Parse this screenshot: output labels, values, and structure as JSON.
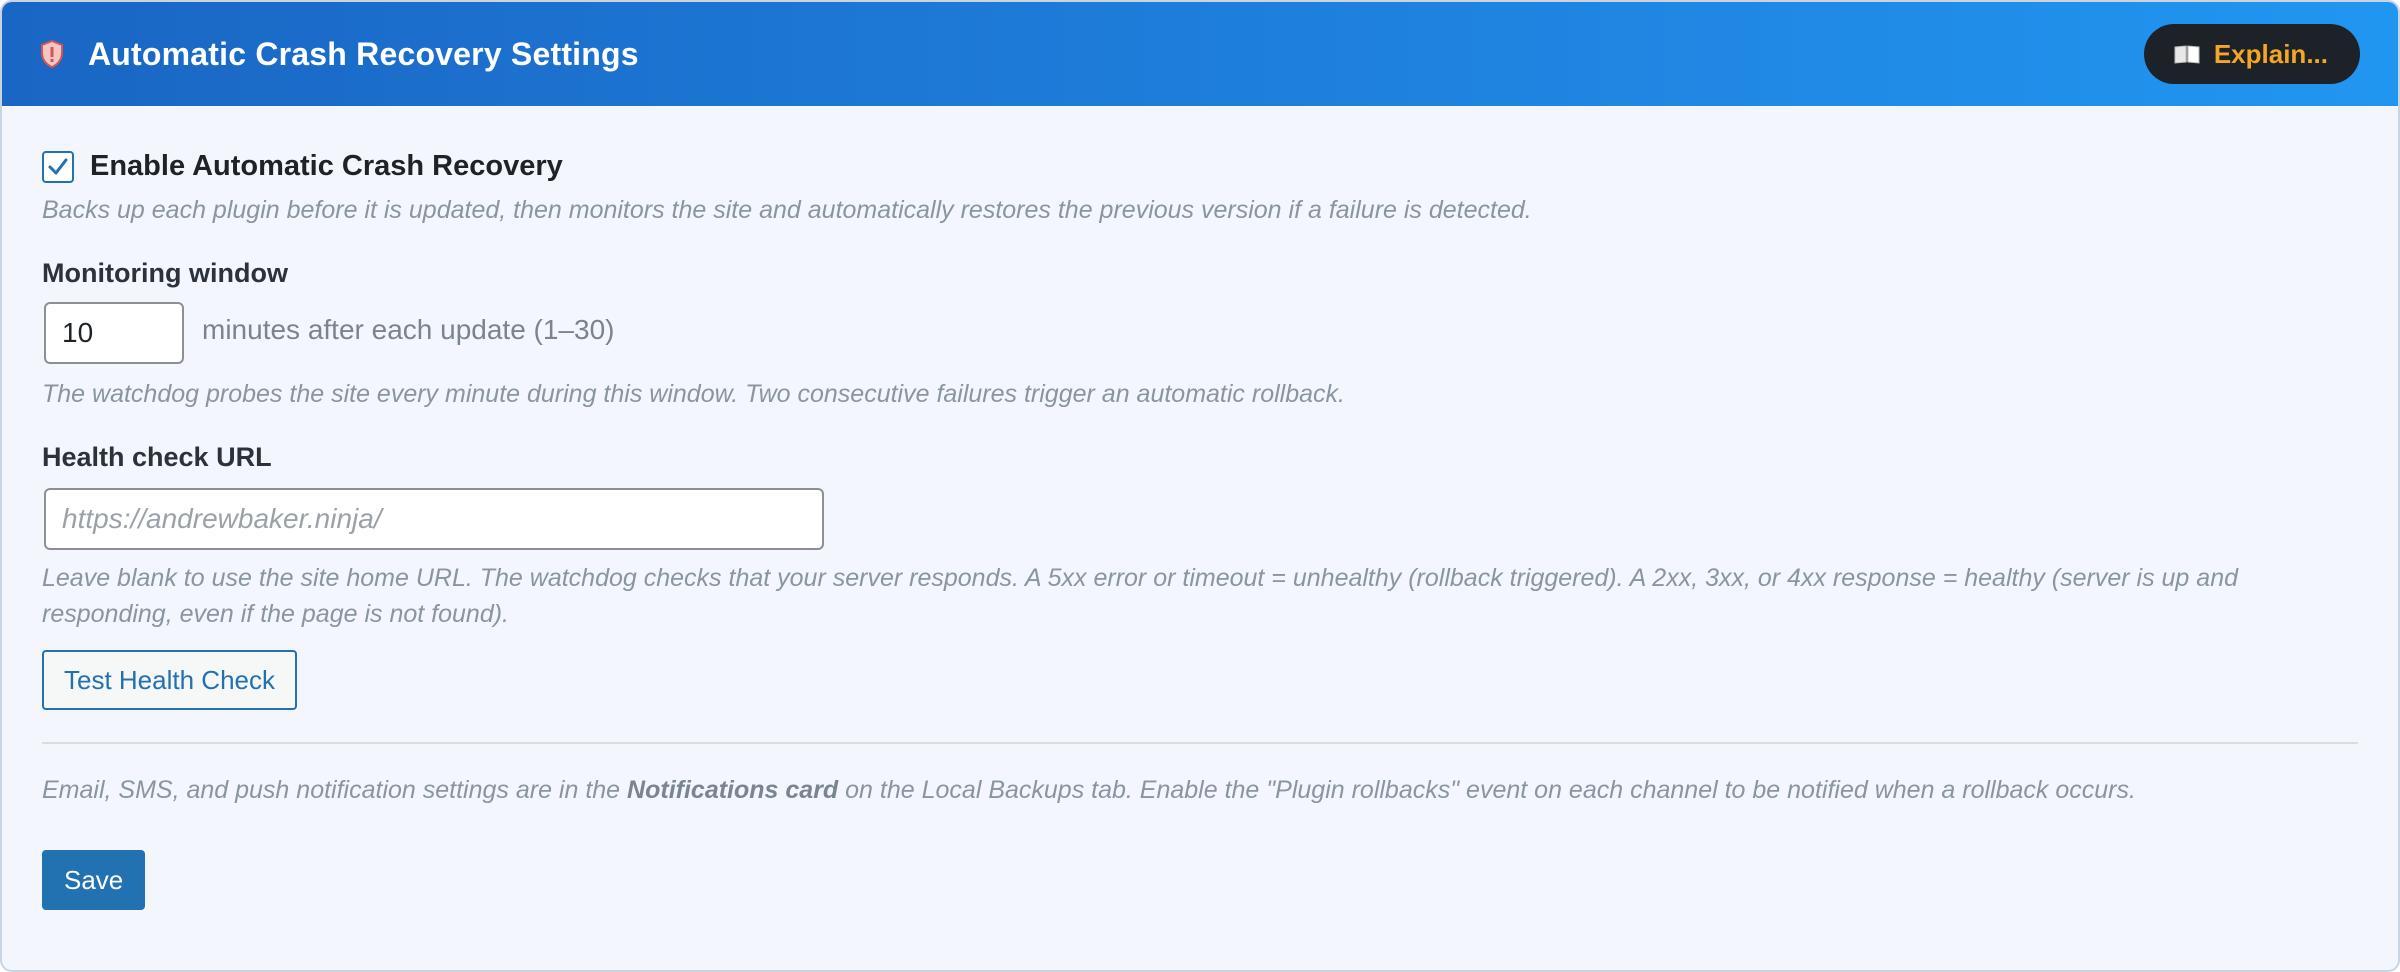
{
  "header": {
    "title": "Automatic Crash Recovery Settings",
    "icon": "shield-icon",
    "explain_label": "Explain...",
    "explain_icon": "book-icon"
  },
  "enable": {
    "checked": true,
    "label": "Enable Automatic Crash Recovery",
    "help": "Backs up each plugin before it is updated, then monitors the site and automatically restores the previous version if a failure is detected."
  },
  "monitoring": {
    "label": "Monitoring window",
    "value": "10",
    "suffix": "minutes after each update (1–30)",
    "help": "The watchdog probes the site every minute during this window. Two consecutive failures trigger an automatic rollback."
  },
  "health": {
    "label": "Health check URL",
    "value": "",
    "placeholder": "https://andrewbaker.ninja/",
    "help": "Leave blank to use the site home URL. The watchdog checks that your server responds. A 5xx error or timeout = unhealthy (rollback triggered). A 2xx, 3xx, or 4xx response = healthy (server is up and responding, even if the page is not found).",
    "test_label": "Test Health Check"
  },
  "notifications": {
    "text_before": "Email, SMS, and push notification settings are in the ",
    "text_bold": "Notifications card",
    "text_after": " on the Local Backups tab. Enable the \"Plugin rollbacks\" event on each channel to be notified when a rollback occurs."
  },
  "save_label": "Save",
  "colors": {
    "header_start": "#1a66c4",
    "header_end": "#2196f0",
    "accent": "#2271b1",
    "explain_text": "#f5a623",
    "explain_bg": "#1d2228"
  }
}
